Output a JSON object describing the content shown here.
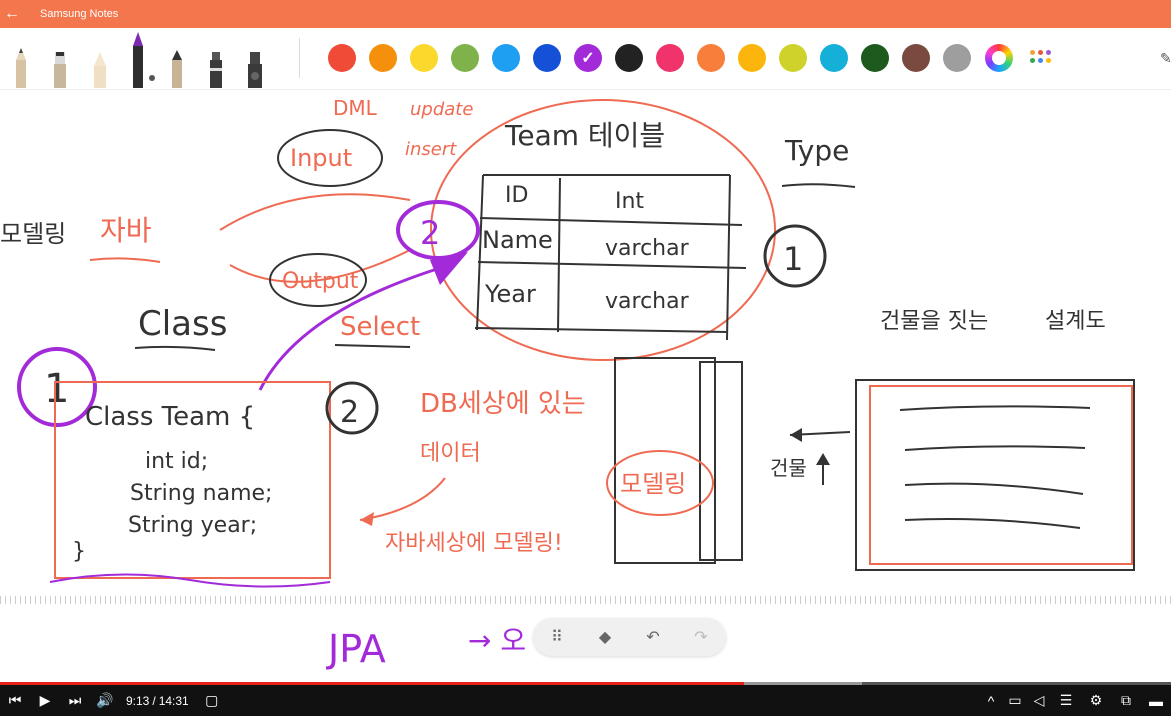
{
  "window": {
    "title": "Samsung Notes"
  },
  "toolbar": {
    "pens": [
      "pencil-tool",
      "brush-tool",
      "crayon-tool",
      "fountain-pen-tool",
      "calligraphy-pen-tool",
      "marker-tool",
      "highlighter-tool"
    ],
    "colors": [
      "#ef4b36",
      "#f5900c",
      "#fbd92c",
      "#7fb24a",
      "#1e9ff2",
      "#1551d6",
      "#a32ad8",
      "#222222",
      "#f0336a",
      "#f77e3b",
      "#fbb50d",
      "#cfd22a",
      "#15b0d8",
      "#1e5a1d",
      "#7b4a3e",
      "#9e9e9e"
    ],
    "selected_color": "#a32ad8"
  },
  "note": {
    "texts": {
      "dml": "DML",
      "update": "update",
      "insert": "insert",
      "input": "Input",
      "team_table": "Team 테이블",
      "type": "Type",
      "modeling": "모델링",
      "java": "자바",
      "id": "ID",
      "int": "Int",
      "name": "Name",
      "varchar1": "varchar",
      "year": "Year",
      "varchar2": "varchar",
      "output": "Output",
      "class": "Class",
      "select": "Select",
      "building": "건물을 짓는",
      "blueprint": "설계도",
      "class_team": "Class Team {",
      "int_id": "int id;",
      "string_name": "String name;",
      "string_year": "String year;",
      "close_brace": "}",
      "db_world": "DB세상에 있는",
      "data": "데이터",
      "java_world_modeling": "자바세상에 모델링!",
      "modeling_box": "모델링",
      "building_up": "건물",
      "jpa": "JPA",
      "arrow_o": "→ 오"
    }
  },
  "player": {
    "current_time": "9:13",
    "duration": "14:31",
    "progress": 0.635
  }
}
